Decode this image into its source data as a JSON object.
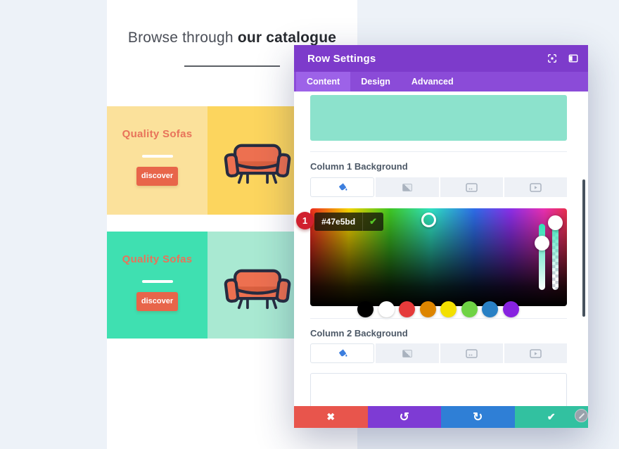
{
  "page": {
    "heading": {
      "normal": "Browse through",
      "bold": "our catalogue"
    },
    "cards": [
      {
        "title": "Quality Sofas",
        "button_label": "discover",
        "left_bg": "#fbe19b",
        "right_bg": "#fcd55e"
      },
      {
        "title": "Quality Sofas",
        "button_label": "discover",
        "left_bg": "#3fe0b1",
        "right_bg": "#a9e9d2"
      }
    ],
    "accents": {
      "card_title_color": "#e8735a",
      "button_bg": "#e8654a"
    }
  },
  "modal": {
    "title": "Row Settings",
    "tabs": [
      {
        "label": "Content"
      },
      {
        "label": "Design"
      },
      {
        "label": "Advanced"
      }
    ],
    "active_tab": "Content",
    "preview_block_color": "#8ce2cc",
    "column1_label": "Column 1 Background",
    "column2_label": "Column 2 Background",
    "color_picker": {
      "hex_value": "#47e5bd",
      "confirm_icon": "✔",
      "annotation_badge": "1",
      "swatches": [
        {
          "name": "black",
          "color": "#000000"
        },
        {
          "name": "white",
          "color": "#ffffff"
        },
        {
          "name": "red",
          "color": "#e53b3b"
        },
        {
          "name": "orange",
          "color": "#dd8500"
        },
        {
          "name": "yellow",
          "color": "#f3e000"
        },
        {
          "name": "green",
          "color": "#6fd344"
        },
        {
          "name": "blue",
          "color": "#2980c4"
        },
        {
          "name": "purple",
          "color": "#8722e0"
        }
      ]
    },
    "footer": {
      "discard_icon": "✖",
      "undo_icon": "↺",
      "redo_icon": "↻",
      "save_icon": "✔",
      "colors": {
        "discard": "#e8554c",
        "undo": "#7e3bd4",
        "redo": "#2f7fd6",
        "save": "#32c1a0"
      }
    }
  }
}
